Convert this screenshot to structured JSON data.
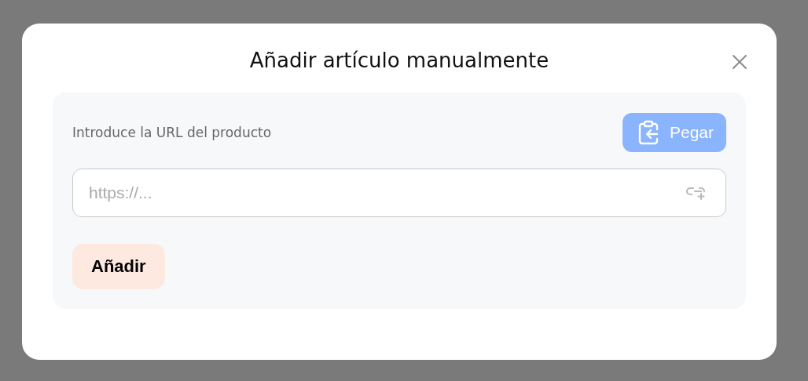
{
  "dialog": {
    "title": "Añadir artículo manualmente"
  },
  "url_form": {
    "label": "Introduce la URL del producto",
    "paste_button": "Pegar",
    "url_input": {
      "placeholder": "https://..."
    },
    "submit_button": "Añadir"
  }
}
